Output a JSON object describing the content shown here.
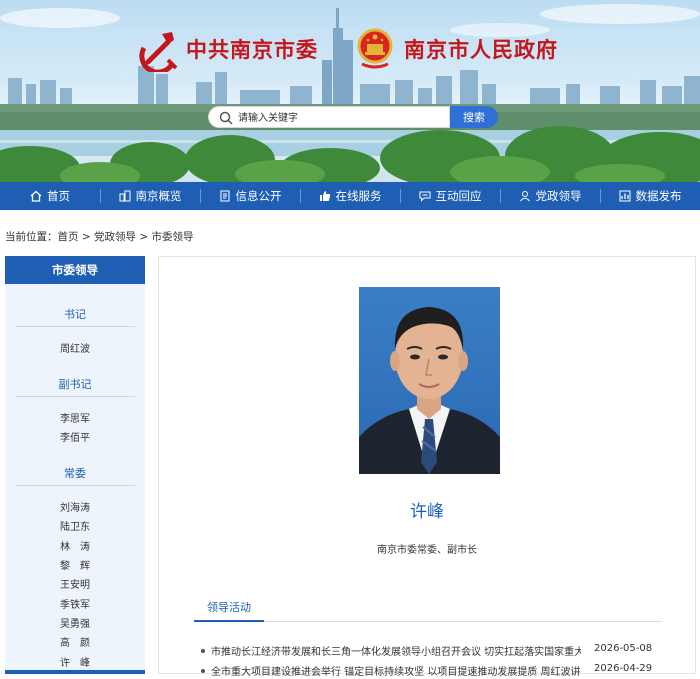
{
  "header": {
    "party_title": "中共南京市委",
    "gov_title": "南京市人民政府",
    "search_placeholder": "请输入关键字",
    "search_button": "搜索"
  },
  "nav": [
    {
      "label": "首页",
      "icon": "home-icon"
    },
    {
      "label": "南京概览",
      "icon": "city-icon"
    },
    {
      "label": "信息公开",
      "icon": "document-icon"
    },
    {
      "label": "在线服务",
      "icon": "thumbs-up-icon"
    },
    {
      "label": "互动回应",
      "icon": "chat-icon"
    },
    {
      "label": "党政领导",
      "icon": "user-icon"
    },
    {
      "label": "数据发布",
      "icon": "chart-icon"
    }
  ],
  "breadcrumb": {
    "prefix": "当前位置：",
    "items": [
      "首页",
      "党政领导",
      "市委领导"
    ],
    "separator": " > "
  },
  "sidebar": {
    "title": "市委领导",
    "sections": [
      {
        "label": "书记",
        "names": [
          "周红波"
        ]
      },
      {
        "label": "副书记",
        "names": [
          "李思军",
          "李佰平"
        ]
      },
      {
        "label": "常委",
        "names": [
          "刘海涛",
          "陆卫东",
          "林　涛",
          "黎　辉",
          "王安明",
          "季铁军",
          "吴勇强",
          "高　颜",
          "许　峰"
        ]
      }
    ]
  },
  "profile": {
    "name": "许峰",
    "title": "南京市委常委、副市长",
    "tab": "领导活动"
  },
  "news": [
    {
      "title": "市推动长江经济带发展和长三角一体化发展领导小组召开会议 切实扛起落实国家重大发...",
      "date": "2026-05-08"
    },
    {
      "title": "全市重大项目建设推进会举行 锚定目标持续攻坚 以项目提速推动发展提质 周红波讲...",
      "date": "2026-04-29"
    }
  ],
  "colors": {
    "primary": "#1e5fb4",
    "title_red": "#c4161c",
    "search_button": "#2f6fd6"
  }
}
